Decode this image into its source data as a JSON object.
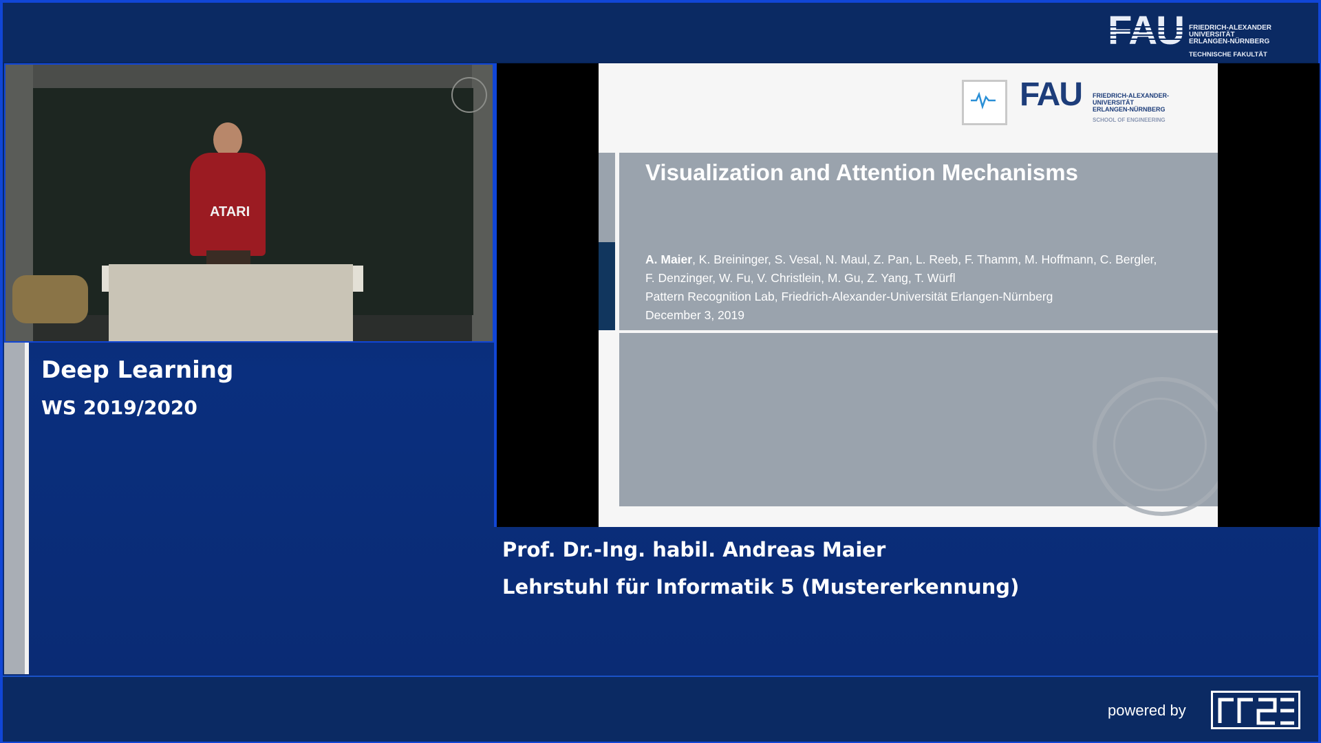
{
  "header": {
    "logo": {
      "main": "FAU",
      "lines": [
        "FRIEDRICH-ALEXANDER",
        "UNIVERSITÄT",
        "ERLANGEN-NÜRNBERG"
      ],
      "faculty": "TECHNISCHE FAKULTÄT"
    }
  },
  "video": {
    "shirt_text": "ATARI"
  },
  "course": {
    "title": "Deep Learning",
    "semester": "WS 2019/2020"
  },
  "slide": {
    "logo": {
      "main": "FAU",
      "lines": [
        "FRIEDRICH-ALEXANDER-",
        "UNIVERSITÄT",
        "ERLANGEN-NÜRNBERG"
      ],
      "school": "SCHOOL OF ENGINEERING"
    },
    "title": "Visualization and Attention Mechanisms",
    "lead_author": "A. Maier",
    "authors_rest_1": ", K. Breininger, S. Vesal, N. Maul, Z. Pan, L. Reeb, F. Thamm, M. Hoffmann, C. Bergler,",
    "authors_2": "F. Denzinger, W. Fu, V. Christlein, M. Gu, Z. Yang, T. Würfl",
    "affiliation": "Pattern Recognition Lab, Friedrich-Alexander-Universität Erlangen-Nürnberg",
    "date": "December 3, 2019"
  },
  "lecturer": {
    "name": "Prof. Dr.-Ing. habil. Andreas Maier",
    "chair": "Lehrstuhl für Informatik 5 (Mustererkennung)"
  },
  "footer": {
    "powered": "powered by"
  },
  "colors": {
    "border": "#1146d6",
    "panel": "#0a2a6a",
    "slide_band": "#9aa3ad",
    "slide_accent": "#11365e"
  }
}
